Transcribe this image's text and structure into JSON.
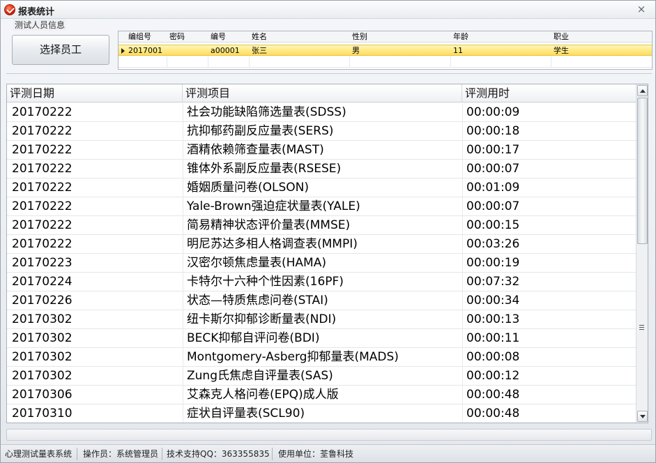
{
  "window": {
    "title": "报表统计",
    "close_glyph": "×",
    "app_icon": "app-logo-icon"
  },
  "staff_info": {
    "group_title": "测试人员信息",
    "select_button": "选择员工",
    "columns": [
      "编组号",
      "密码",
      "编号",
      "姓名",
      "性别",
      "年龄",
      "职业"
    ],
    "rows": [
      [
        "2017001",
        "",
        "a00001",
        "张三",
        "男",
        "11",
        "学生"
      ]
    ]
  },
  "records": {
    "columns": [
      "评测日期",
      "评测项目",
      "评测用时"
    ],
    "rows": [
      [
        "20170222",
        "社会功能缺陷筛选量表(SDSS)",
        "00:00:09"
      ],
      [
        "20170222",
        "抗抑郁药副反应量表(SERS)",
        "00:00:18"
      ],
      [
        "20170222",
        "酒精依赖筛查量表(MAST)",
        "00:00:17"
      ],
      [
        "20170222",
        "锥体外系副反应量表(RSESE)",
        "00:00:07"
      ],
      [
        "20170222",
        "婚姻质量问卷(OLSON)",
        "00:01:09"
      ],
      [
        "20170222",
        "Yale-Brown强迫症状量表(YALE)",
        "00:00:07"
      ],
      [
        "20170222",
        "简易精神状态评价量表(MMSE)",
        "00:00:15"
      ],
      [
        "20170222",
        "明尼苏达多相人格调查表(MMPI)",
        "00:03:26"
      ],
      [
        "20170223",
        "汉密尔顿焦虑量表(HAMA)",
        "00:00:19"
      ],
      [
        "20170224",
        "卡特尔十六种个性因素(16PF)",
        "00:07:32"
      ],
      [
        "20170226",
        "状态—特质焦虑问卷(STAI)",
        "00:00:34"
      ],
      [
        "20170302",
        "纽卡斯尔抑郁诊断量表(NDI)",
        "00:00:13"
      ],
      [
        "20170302",
        "BECK抑郁自评问卷(BDI)",
        "00:00:11"
      ],
      [
        "20170302",
        "Montgomery-Asberg抑郁量表(MADS)",
        "00:00:08"
      ],
      [
        "20170302",
        "Zung氏焦虑自评量表(SAS)",
        "00:00:12"
      ],
      [
        "20170306",
        "艾森克人格问卷(EPQ)成人版",
        "00:00:48"
      ],
      [
        "20170310",
        "症状自评量表(SCL90)",
        "00:00:48"
      ]
    ]
  },
  "status_bar": {
    "system": "心理测试量表系统",
    "operator": "操作员：系统管理员",
    "support": "技术支持QQ：363355835",
    "unit": "使用单位：荃鲁科技"
  },
  "colors": {
    "selected_row": "#ffde5a",
    "app_icon": "#d2230e"
  }
}
